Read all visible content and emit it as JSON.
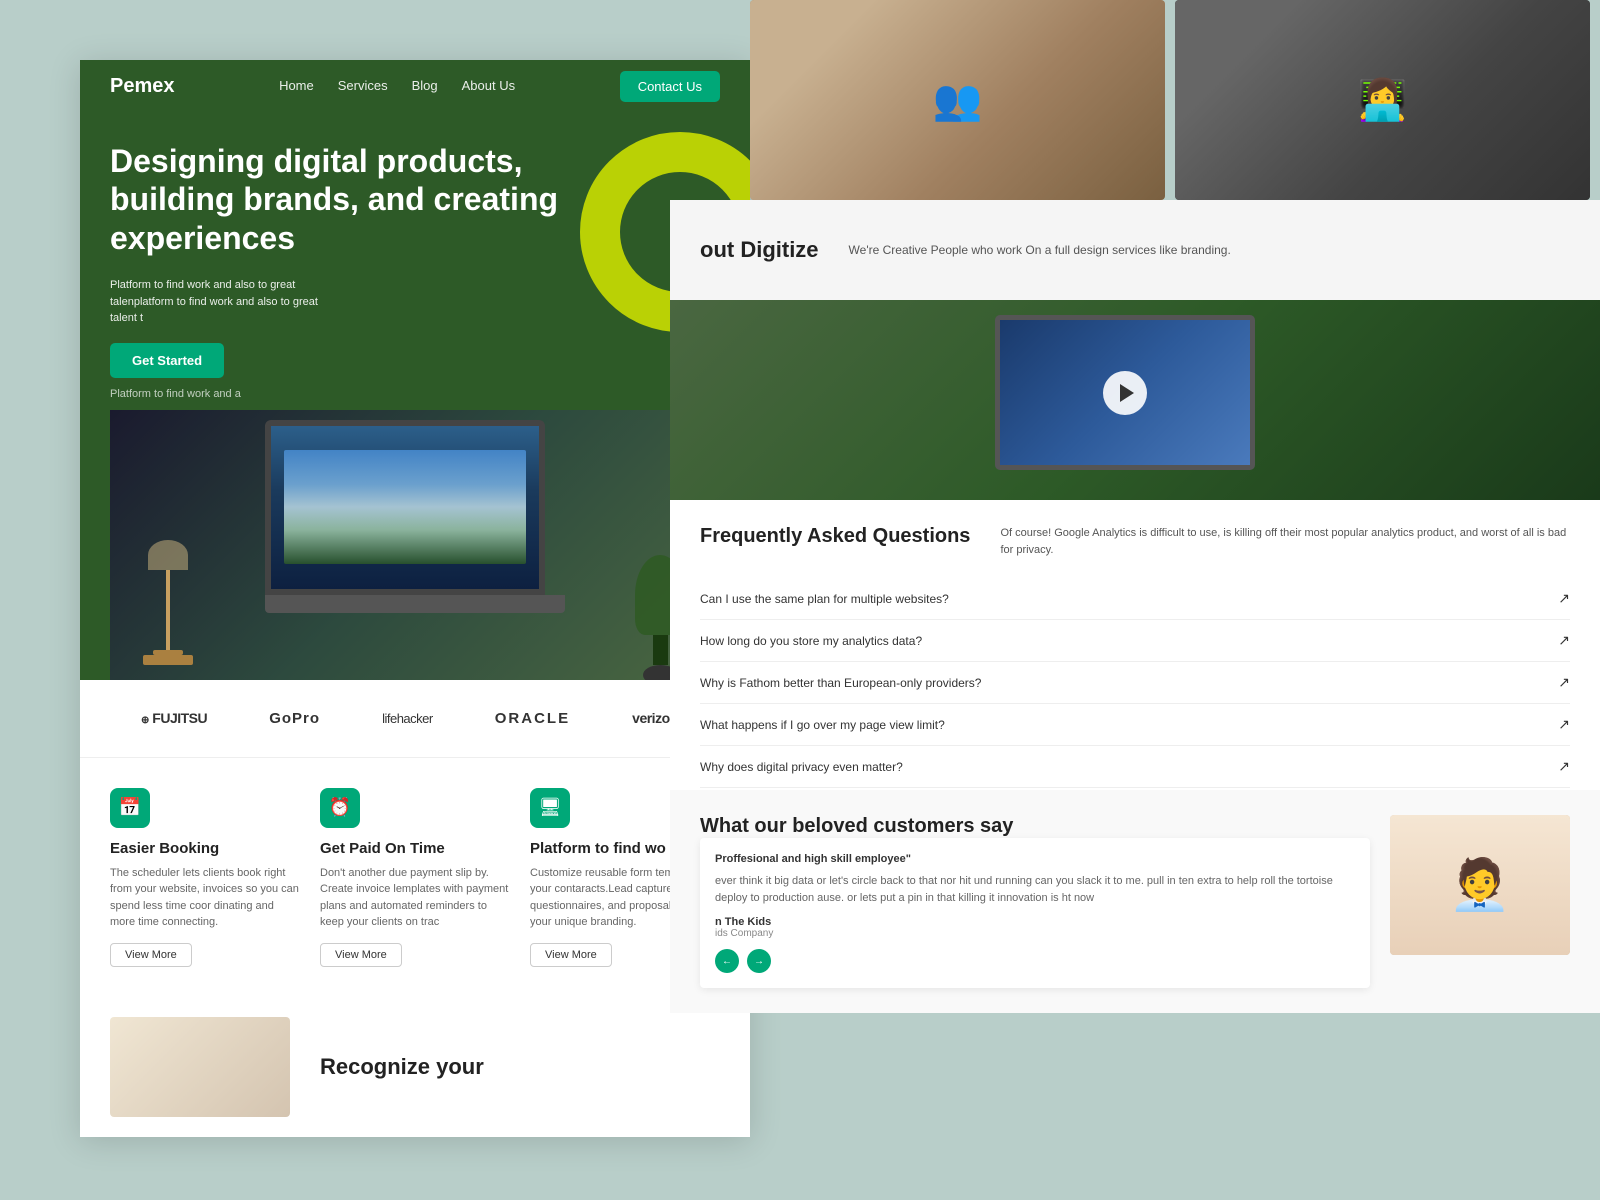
{
  "site": {
    "background_color": "#b8cec9"
  },
  "nav": {
    "logo": "Pemex",
    "links": [
      "Home",
      "Services",
      "Blog",
      "About Us"
    ],
    "contact_button": "Contact Us"
  },
  "hero": {
    "title": "Designing digital products, building brands, and creating experiences",
    "description": "Platform to find work and also to great talenplatform to find work and also to great talent t",
    "subtext": "Platform to find work and a",
    "cta_button": "Get Started"
  },
  "brands": {
    "logos": [
      "FUJITSU",
      "GoPro",
      "lifehacker",
      "ORACLE",
      "verizon✓"
    ]
  },
  "features": [
    {
      "icon": "📅",
      "title": "Easier Booking",
      "description": "The scheduler lets clients book right from your website, invoices so you can spend less time coor dinating and more time connecting.",
      "button": "View More"
    },
    {
      "icon": "⏰",
      "title": "Get Paid On Time",
      "description": "Don't another due payment slip by. Create invoice lemplates with payment plans and automated reminders to keep your clients on trac",
      "button": "View More"
    },
    {
      "icon": "🖥",
      "title": "Platform to find wo",
      "description": "Customize reusable form templates for your contaracts.Lead capture forms, questionnaires, and proposals all with your unique branding.",
      "button": "View More"
    }
  ],
  "recognize": {
    "title": "Recognize your"
  },
  "about": {
    "title": "out Digitize",
    "description": "We're Creative People who work On a full design services like branding."
  },
  "faq": {
    "title": "Frequently Asked Questions",
    "description": "Of course! Google Analytics is difficult to use, is killing off their most popular analytics product, and worst of all is bad for privacy.",
    "items": [
      "Can I use the same plan for multiple websites?",
      "How long do you store my analytics data?",
      "Why is Fathom better than European-only providers?",
      "What happens if I go over my page view limit?",
      "Why does digital privacy even matter?"
    ]
  },
  "testimonials": {
    "section_title": "What our beloved customers say",
    "badge": "Proffesional and high skill employee\"",
    "text": "ever think it big data or let's circle back to that nor hit und running can you slack it to me. pull in ten extra to help roll the tortoise deploy to production ause. or lets put a pin in that killing it innovation is ht now",
    "author": "n The Kids",
    "company": "ids Company",
    "nav_prev": "←",
    "nav_next": "→"
  }
}
